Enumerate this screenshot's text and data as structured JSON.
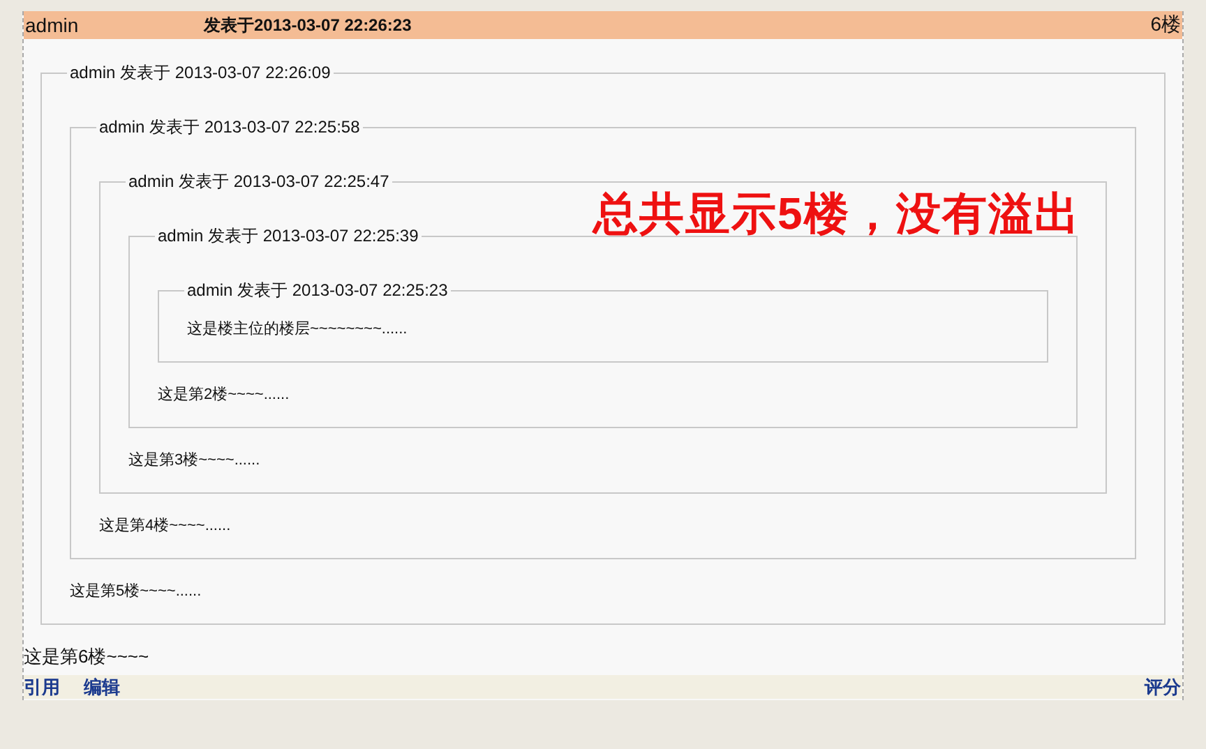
{
  "post": {
    "author": "admin",
    "posted": "发表于2013-03-07 22:26:23",
    "floor": "6楼",
    "quote": {
      "legend": "admin 发表于 2013-03-07 22:26:09",
      "text": "这是第5楼~~~~......",
      "quote": {
        "legend": "admin 发表于 2013-03-07 22:25:58",
        "text": "这是第4楼~~~~......",
        "quote": {
          "legend": "admin 发表于 2013-03-07 22:25:47",
          "text": "这是第3楼~~~~......",
          "quote": {
            "legend": "admin 发表于 2013-03-07 22:25:39",
            "text": "这是第2楼~~~~......",
            "quote": {
              "legend": "admin 发表于 2013-03-07 22:25:23",
              "text": "这是楼主位的楼层~~~~~~~~......"
            }
          }
        }
      }
    },
    "body": "这是第6楼~~~~",
    "annotation": "总共显示5楼，没有溢出",
    "actions_left": [
      "引用",
      "编辑"
    ],
    "actions_right": [
      "评分"
    ]
  }
}
